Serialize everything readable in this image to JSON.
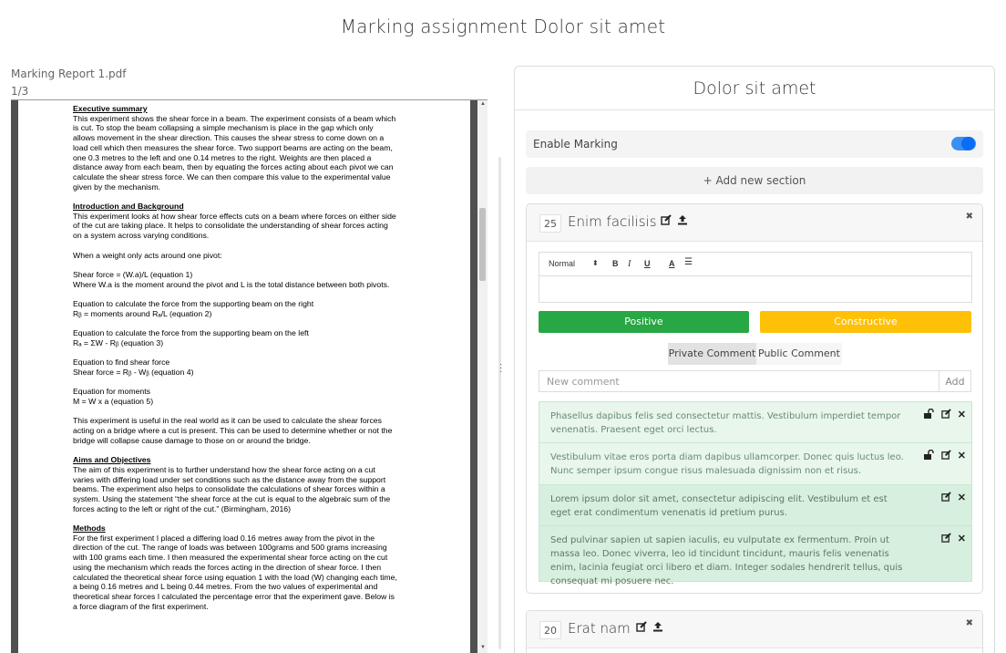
{
  "page": {
    "title": "Marking assignment Dolor sit amet"
  },
  "document": {
    "filename": "Marking Report 1.pdf",
    "page_indicator": "1/3",
    "content": {
      "exec_heading": "Executive summary",
      "exec_lines": [
        "This experiment shows the shear force in a beam. The experiment consists of a beam which",
        "is cut. To stop the beam collapsing a simple mechanism is place in the gap which only",
        "allows movement in the shear direction. This causes the shear stress to come down on a",
        "load cell which then measures the shear force. Two support beams are acting on the beam,",
        "one 0.3 metres to the left and one 0.14 metres to the right. Weights are then placed a",
        "distance away from each beam, then by equating the forces acting about each pivot we can",
        "calculate the shear stress force. We can then compare this value to the experimental value",
        "given by the mechanism."
      ],
      "intro_heading": "Introduction and Background",
      "intro_lines": [
        "This experiment looks at how shear force effects cuts on a beam where forces on either side",
        "of the cut are taking place. It helps to consolidate the understanding of shear forces acting",
        "on a system across varying conditions."
      ],
      "pivot_line": "When a weight only acts around one pivot:",
      "eq1_lines": [
        "Shear force = (W.a)/L  (equation 1)",
        "Where W.a is the moment around the pivot and L is the total distance between both pivots."
      ],
      "eq2_lines": [
        "Equation to calculate the force from the supporting beam on the right",
        "Rᵦ = moments around Rₐ/L  (equation 2)"
      ],
      "eq3_lines": [
        "Equation to calculate the force from the supporting beam on the left",
        "Rₐ = ΣW - Rᵦ (equation 3)"
      ],
      "eq4_lines": [
        "Equation to find shear force",
        "Shear force = Rᵦ - Wᵦ (equation 4)"
      ],
      "eq5_lines": [
        "Equation for moments",
        "M = W x a (equation 5)"
      ],
      "useful_lines": [
        "This experiment is useful in the real world as it can be used to calculate the shear forces",
        "acting on a bridge where a cut is present. This can be used to determine whether or not the",
        "bridge will collapse cause damage to those on or around the bridge."
      ],
      "aims_heading": "Aims and Objectives",
      "aims_lines": [
        "The aim of this experiment is to further understand how the shear force acting on a cut",
        "varies with differing load under set conditions such as the distance away from the support",
        "beams. The experiment also helps to consolidate the calculations of shear forces within a",
        "system. Using the statement “the shear force at the cut is equal to the algebraic sum of the",
        "forces acting to the left or right of the cut.” (Birmingham, 2016)"
      ],
      "methods_heading": "Methods",
      "methods_lines": [
        "For the first experiment I placed a differing load 0.16 metres away from the pivot in the",
        "direction of the cut. The range of loads was between 100grams and 500 grams increasing",
        "with 100 grams each time. I then measured the experimental shear force acting on the cut",
        "using the mechanism which reads the forces acting in the direction of shear force. I then",
        "calculated the theoretical shear force using equation 1 with the load (W) changing each time,",
        "a being 0.16 metres and L being 0.44 metres. From the two values of experimental and",
        "theoretical shear forces I calculated the percentage error that the experiment gave. Below is",
        "a force diagram of the first experiment."
      ]
    }
  },
  "panel": {
    "title": "Dolor sit amet",
    "enable_marking_label": "Enable Marking",
    "enable_marking_on": true,
    "add_section_label": "+ Add new section",
    "sections": [
      {
        "score": "25",
        "title": "Enim facilisis",
        "editor": {
          "format": "Normal",
          "bold": "B",
          "italic": "I",
          "underline": "U",
          "color": "A"
        },
        "positive_label": "Positive",
        "constructive_label": "Constructive",
        "tabs": [
          "Private Comment",
          "Public Comment"
        ],
        "comment_placeholder": "New comment",
        "add_label": "Add",
        "comments": [
          "Phasellus dapibus felis sed consectetur mattis. Vestibulum imperdiet tempor venenatis. Praesent eget orci lectus.",
          "Vestibulum vitae eros porta diam dapibus ullamcorper. Donec quis luctus leo. Nunc semper ipsum congue risus malesuada dignissim non et risus.",
          "Lorem ipsum dolor sit amet, consectetur adipiscing elit. Vestibulum et est eget erat condimentum venenatis id pretium purus.",
          "Sed pulvinar sapien ut sapien iaculis, eu vulputate ex fermentum. Proin ut massa leo. Donec viverra, leo id tincidunt tincidunt, mauris felis venenatis enim, lacinia feugiat orci libero et diam. Integer sodales hendrerit tellus, quis consequat mi posuere nec."
        ]
      },
      {
        "score": "20",
        "title": "Erat nam"
      }
    ]
  },
  "colors": {
    "positive": "#28a745",
    "constructive": "#ffc107",
    "toggle": "#0b6cf5",
    "comment_bg": "#e8f6ec"
  }
}
